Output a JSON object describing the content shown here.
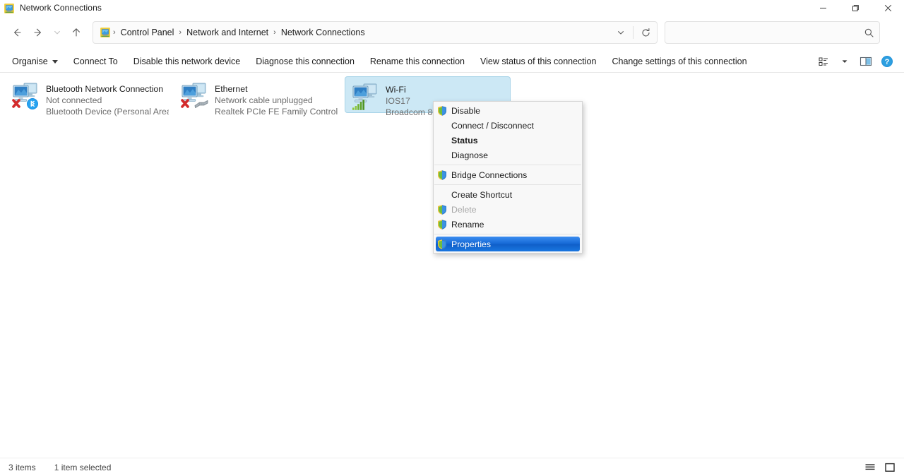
{
  "window": {
    "title": "Network Connections",
    "app_icon": "network-connections-icon",
    "controls": {
      "minimize": "minimize-icon",
      "maximize": "maximize-icon",
      "close": "close-icon"
    }
  },
  "navbar": {
    "back": "back-arrow-icon",
    "forward": "forward-arrow-icon",
    "recent": "chevron-down-icon",
    "up": "up-arrow-icon",
    "address_icon": "network-connections-icon",
    "breadcrumbs": [
      {
        "label": "Control Panel"
      },
      {
        "label": "Network and Internet"
      },
      {
        "label": "Network Connections"
      }
    ],
    "separator": "›",
    "dropdown": "chevron-down-icon",
    "refresh": "refresh-icon",
    "search": {
      "value": "",
      "placeholder": "",
      "icon": "search-icon"
    }
  },
  "commandbar": {
    "items": [
      {
        "label": "Organise",
        "has_caret": true
      },
      {
        "label": "Connect To",
        "has_caret": false
      },
      {
        "label": "Disable this network device",
        "has_caret": false
      },
      {
        "label": "Diagnose this connection",
        "has_caret": false
      },
      {
        "label": "Rename this connection",
        "has_caret": false
      },
      {
        "label": "View status of this connection",
        "has_caret": false
      },
      {
        "label": "Change settings of this connection",
        "has_caret": false
      }
    ],
    "right_icons": [
      {
        "name": "view-options-icon"
      },
      {
        "name": "view-options-caret-icon"
      },
      {
        "name": "preview-pane-icon"
      },
      {
        "name": "help-icon"
      }
    ]
  },
  "connections": [
    {
      "name": "Bluetooth Network Connection",
      "status": "Not connected",
      "device": "Bluetooth Device (Personal Area ...",
      "icon": "bluetooth-network-adapter-icon",
      "selected": false,
      "badge": "bluetooth",
      "disconnected": true
    },
    {
      "name": "Ethernet",
      "status": "Network cable unplugged",
      "device": "Realtek PCIe FE Family Controller",
      "icon": "ethernet-adapter-icon",
      "selected": false,
      "badge": "cable",
      "disconnected": true
    },
    {
      "name": "Wi-Fi",
      "status": "IOS17",
      "device": "Broadcom 802",
      "icon": "wifi-adapter-icon",
      "selected": true,
      "badge": "signal",
      "disconnected": false
    }
  ],
  "context_menu": {
    "items": [
      {
        "label": "Disable",
        "shield": true,
        "bold": false,
        "disabled": false,
        "highlighted": false
      },
      {
        "label": "Connect / Disconnect",
        "shield": false,
        "bold": false,
        "disabled": false,
        "highlighted": false
      },
      {
        "label": "Status",
        "shield": false,
        "bold": true,
        "disabled": false,
        "highlighted": false
      },
      {
        "label": "Diagnose",
        "shield": false,
        "bold": false,
        "disabled": false,
        "highlighted": false
      },
      {
        "separator": true
      },
      {
        "label": "Bridge Connections",
        "shield": true,
        "bold": false,
        "disabled": false,
        "highlighted": false
      },
      {
        "separator": true
      },
      {
        "label": "Create Shortcut",
        "shield": false,
        "bold": false,
        "disabled": false,
        "highlighted": false
      },
      {
        "label": "Delete",
        "shield": true,
        "bold": false,
        "disabled": true,
        "highlighted": false
      },
      {
        "label": "Rename",
        "shield": true,
        "bold": false,
        "disabled": false,
        "highlighted": false
      },
      {
        "separator": true
      },
      {
        "label": "Properties",
        "shield": true,
        "bold": false,
        "disabled": false,
        "highlighted": true
      }
    ]
  },
  "statusbar": {
    "item_count": "3 items",
    "selection": "1 item selected",
    "views": [
      {
        "name": "details-view-icon"
      },
      {
        "name": "large-icons-view-icon"
      }
    ]
  },
  "colors": {
    "selection_fill": "#cce8f5",
    "selection_border": "#a9d4e8",
    "menu_highlight": "#1569d6",
    "accent_blue": "#0078d4",
    "text_primary": "#1b1b1b",
    "text_secondary": "#6c6c6c"
  }
}
